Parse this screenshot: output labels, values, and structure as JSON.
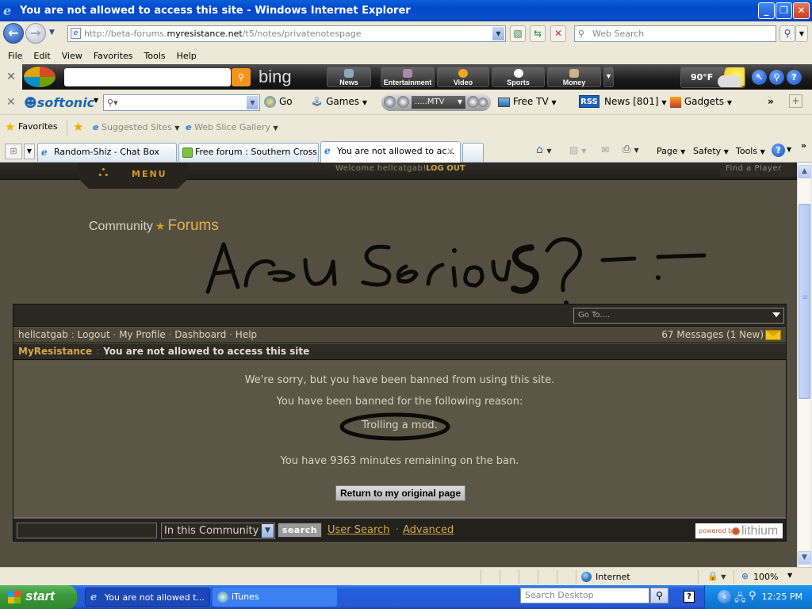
{
  "window": {
    "title": "You are not allowed to access this site - Windows Internet Explorer",
    "minimize": "_",
    "restore": "❐",
    "close": "✕"
  },
  "address": {
    "url_prefix": "http://beta-forums.",
    "url_domain": "myresistance.net",
    "url_path": "/t5/notes/privatenotespage",
    "search_placeholder": "Web Search"
  },
  "menu": [
    "File",
    "Edit",
    "View",
    "Favorites",
    "Tools",
    "Help"
  ],
  "bing_toolbar": {
    "categories": [
      "News",
      "Entertainment",
      "Video",
      "Sports",
      "Money"
    ],
    "logo": "bing",
    "weather": "90°F"
  },
  "softonic_toolbar": {
    "logo": "softonic",
    "go": "Go",
    "games": "Games",
    "radio_station": ".....MTV",
    "free_tv": "Free TV",
    "rss_badge": "RSS",
    "news": "News [801]",
    "gadgets": "Gadgets"
  },
  "favorites_bar": {
    "favorites": "Favorites",
    "suggested": "Suggested Sites",
    "web_slice": "Web Slice Gallery"
  },
  "tabs": [
    {
      "label": "Random-Shiz - Chat Box",
      "active": false
    },
    {
      "label": "Free forum : Southern Cross",
      "active": false
    },
    {
      "label": "You are not allowed to ac...",
      "active": true
    }
  ],
  "command_bar": {
    "page": "Page",
    "safety": "Safety",
    "tools": "Tools"
  },
  "site": {
    "menu": "MENU",
    "welcome": "Welcome hellcatgab!",
    "logout_top": "LOG OUT",
    "find_player": "Find a Player",
    "title_community": "Community",
    "title_forums": "Forums",
    "scrawl": "Are u Serious?  -.-",
    "goto_placeholder": "Go To....",
    "user_nav": {
      "username": "hellcatgab",
      "links": [
        "Logout",
        "My Profile",
        "Dashboard",
        "Help"
      ],
      "messages": "67 Messages (1 New)"
    },
    "breadcrumb": {
      "home": "MyResistance",
      "current": "You are not allowed to access this site"
    },
    "ban": {
      "line1": "We're sorry, but you have been banned from using this site.",
      "line2": "You have been banned for the following reason:",
      "reason": "Trolling a mod.",
      "remaining": "You have 9363 minutes remaining on the ban.",
      "return_button": "Return to my original page"
    },
    "search": {
      "input_value": "",
      "scope": "In this Community",
      "button": "search",
      "user_search": "User Search",
      "advanced": "Advanced",
      "powered_by": "powered by",
      "brand": "lithium"
    }
  },
  "status_bar": {
    "zone": "Internet",
    "zoom": "100%"
  },
  "taskbar": {
    "start": "start",
    "tasks": [
      "You are not allowed t...",
      "iTunes"
    ],
    "search_placeholder": "Search Desktop",
    "clock": "12:25 PM"
  }
}
